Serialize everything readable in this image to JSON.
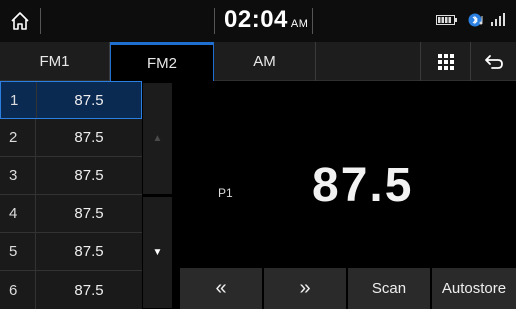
{
  "status_bar": {
    "time": "02:04",
    "ampm": "AM",
    "home_icon": "home-icon",
    "battery_icon": "battery-icon",
    "bluetooth_icon": "bluetooth-audio-icon",
    "signal_icon": "signal-icon"
  },
  "tabs": [
    {
      "label": "FM1",
      "active": false
    },
    {
      "label": "FM2",
      "active": true
    },
    {
      "label": "AM",
      "active": false
    }
  ],
  "tab_actions": {
    "grid_icon": "grid-icon",
    "back_icon": "back-icon"
  },
  "presets": [
    {
      "number": "1",
      "frequency": "87.5",
      "selected": true
    },
    {
      "number": "2",
      "frequency": "87.5",
      "selected": false
    },
    {
      "number": "3",
      "frequency": "87.5",
      "selected": false
    },
    {
      "number": "4",
      "frequency": "87.5",
      "selected": false
    },
    {
      "number": "5",
      "frequency": "87.5",
      "selected": false
    },
    {
      "number": "6",
      "frequency": "87.5",
      "selected": false
    }
  ],
  "scroll": {
    "up_glyph": "▲",
    "down_glyph": "▼"
  },
  "now_playing": {
    "preset_label": "P1",
    "frequency": "87.5"
  },
  "controls": {
    "seek_back": "«",
    "seek_forward": "»",
    "scan": "Scan",
    "autostore": "Autostore"
  },
  "colors": {
    "accent": "#1e6fd0",
    "selected_bg": "#0a2a52",
    "background": "#000000"
  }
}
